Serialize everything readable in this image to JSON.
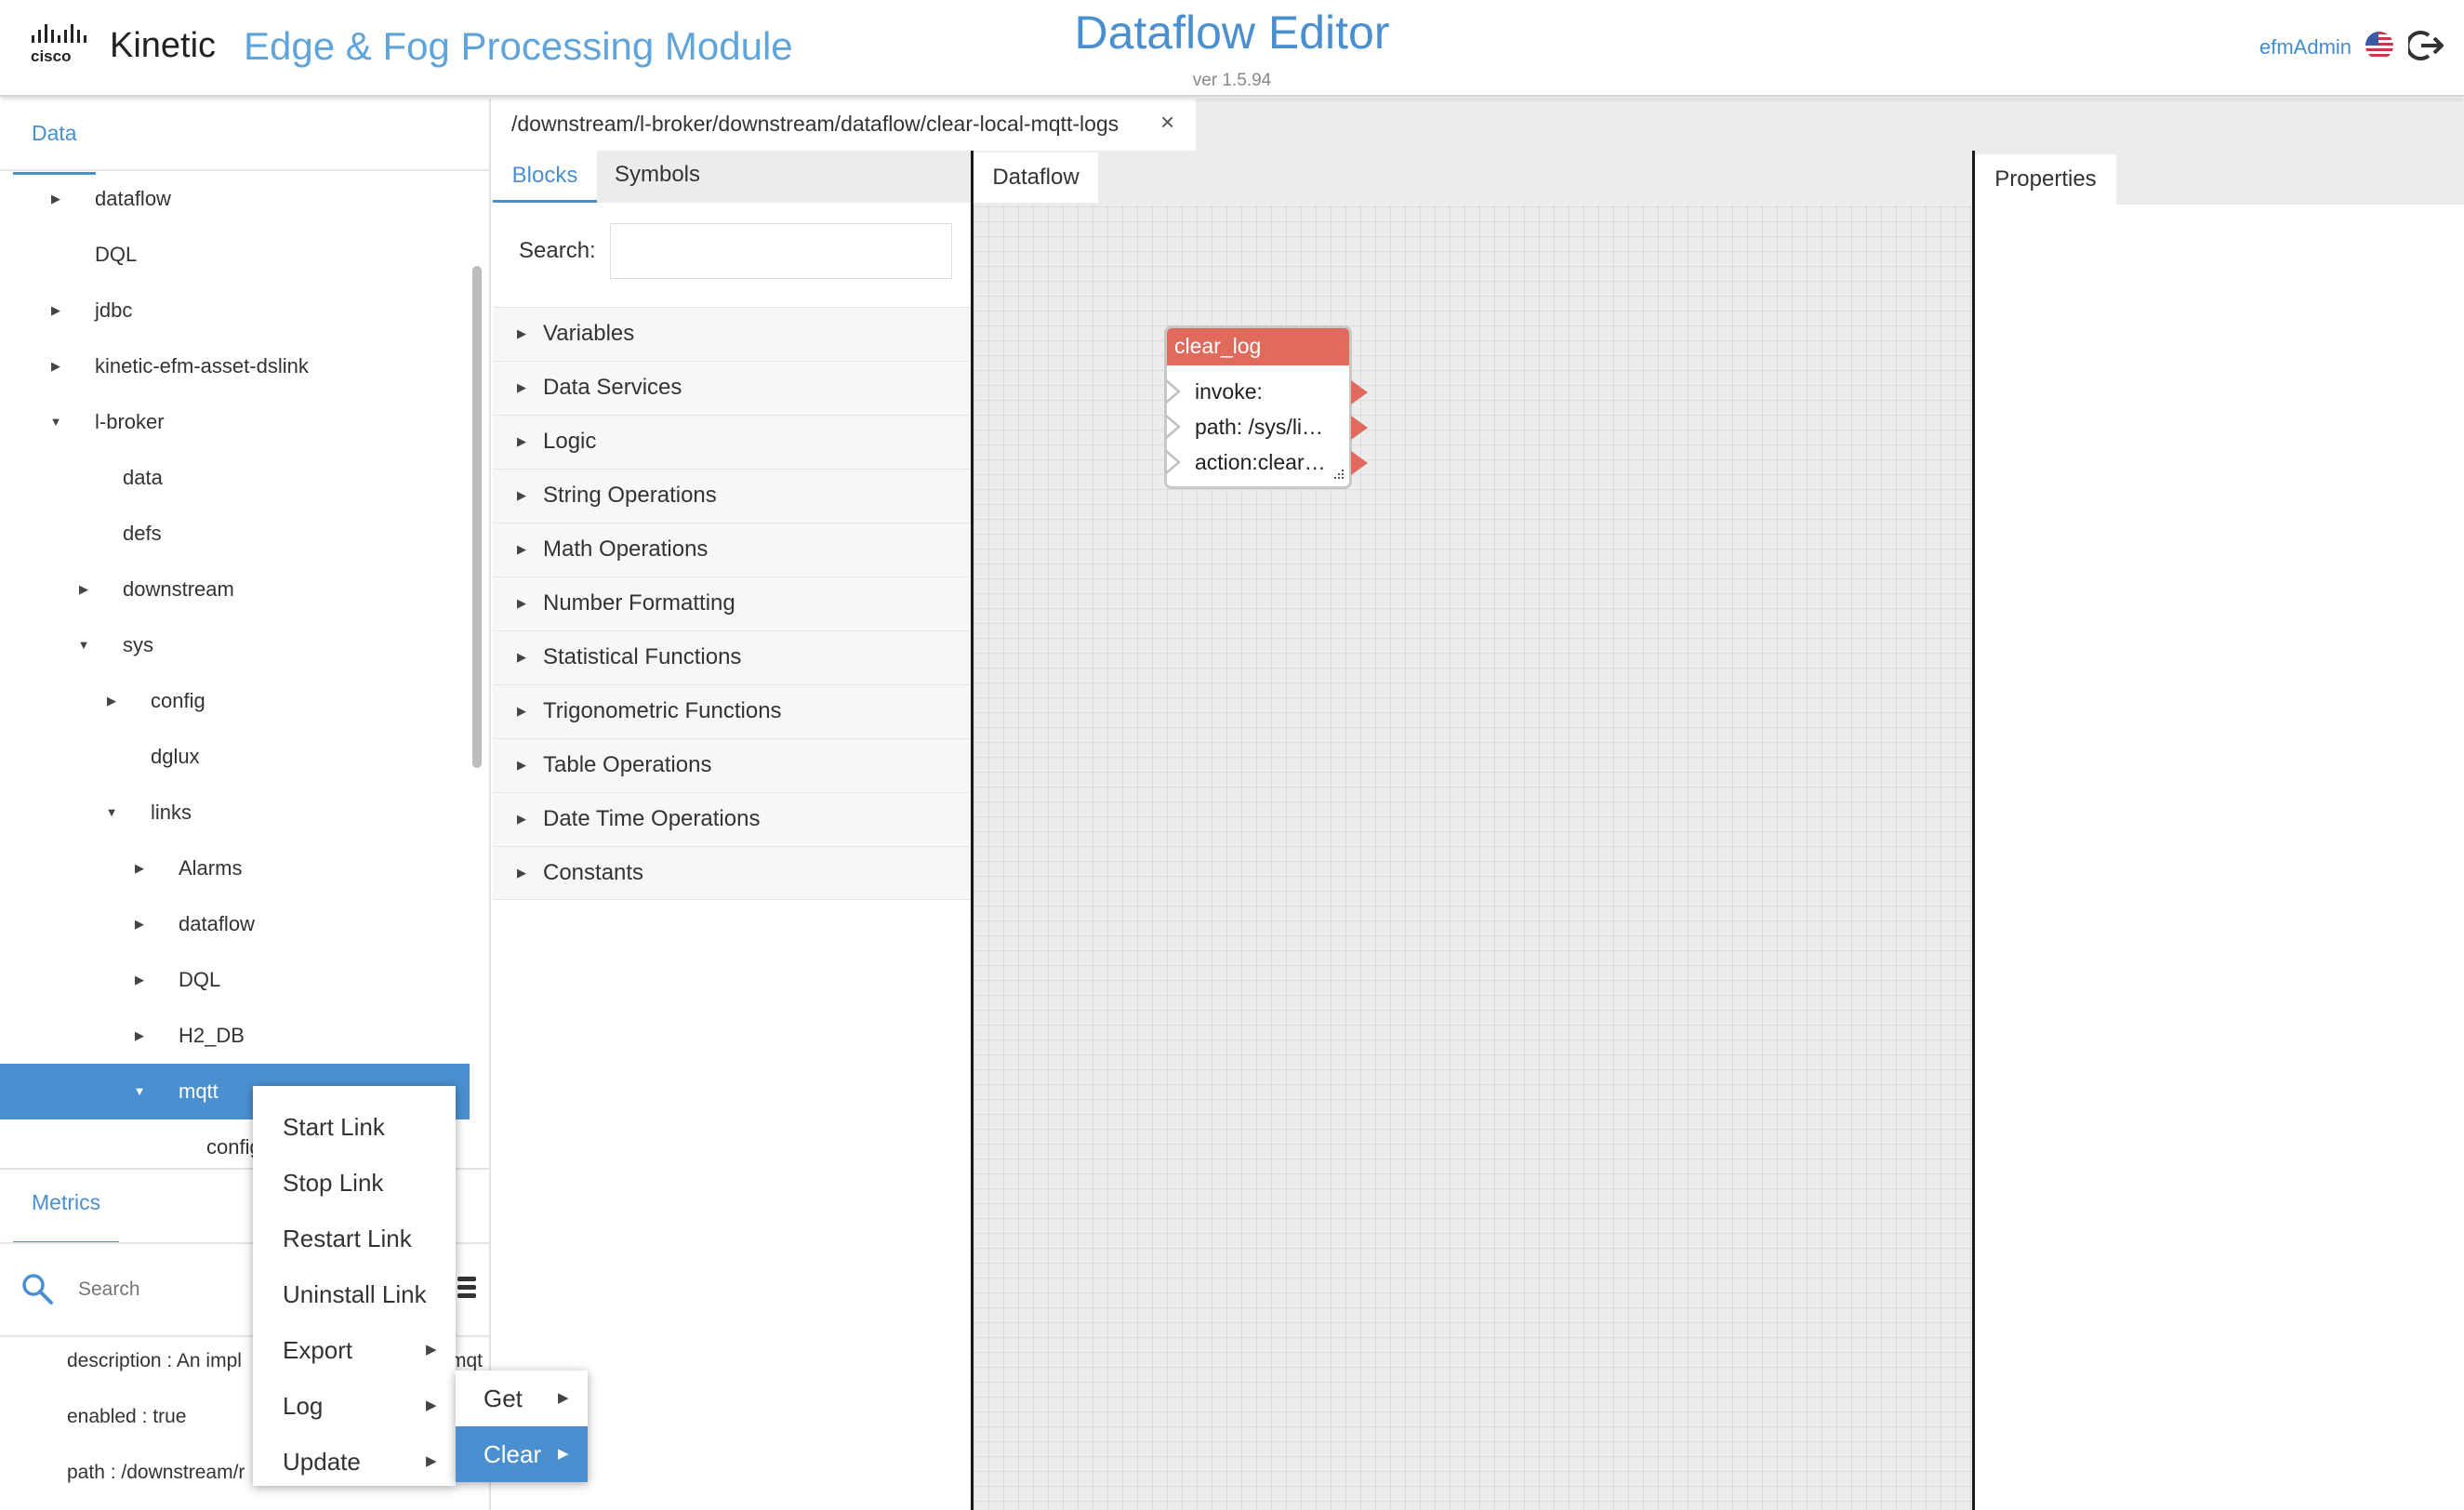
{
  "header": {
    "brand": "Kinetic",
    "module_title": "Edge & Fog Processing Module",
    "app_title": "Dataflow Editor",
    "version": "ver 1.5.94",
    "user": "efmAdmin"
  },
  "left_panel": {
    "tab_label": "Data",
    "tree": [
      {
        "label": "dataflow",
        "caret": "▶"
      },
      {
        "label": "DQL",
        "caret": ""
      },
      {
        "label": "jdbc",
        "caret": "▶"
      },
      {
        "label": "kinetic-efm-asset-dslink",
        "caret": "▶"
      },
      {
        "label": "l-broker",
        "caret": "▼"
      },
      {
        "label": "data",
        "caret": ""
      },
      {
        "label": "defs",
        "caret": ""
      },
      {
        "label": "downstream",
        "caret": "▶"
      },
      {
        "label": "sys",
        "caret": "▼"
      },
      {
        "label": "config",
        "caret": "▶"
      },
      {
        "label": "dglux",
        "caret": ""
      },
      {
        "label": "links",
        "caret": "▼"
      },
      {
        "label": "Alarms",
        "caret": "▶"
      },
      {
        "label": "dataflow",
        "caret": "▶"
      },
      {
        "label": "DQL",
        "caret": "▶"
      },
      {
        "label": "H2_DB",
        "caret": "▶"
      },
      {
        "label": "mqtt",
        "caret": "▼"
      },
      {
        "label": "config",
        "caret": ""
      }
    ]
  },
  "metrics": {
    "tab_label": "Metrics",
    "search_placeholder": "Search",
    "rows": [
      {
        "text": "description : An impl",
        "suffix": "mqt"
      },
      {
        "text": "enabled : true",
        "suffix": ""
      },
      {
        "text": "path : /downstream/r",
        "suffix": ""
      }
    ]
  },
  "path_tab": {
    "label": "/downstream/l-broker/downstream/dataflow/clear-local-mqtt-logs",
    "close": "×"
  },
  "blocks_panel": {
    "tabs": [
      "Blocks",
      "Symbols"
    ],
    "search_label": "Search:",
    "categories": [
      "Variables",
      "Data Services",
      "Logic",
      "String Operations",
      "Math Operations",
      "Number Formatting",
      "Statistical Functions",
      "Trigonometric Functions",
      "Table Operations",
      "Date Time Operations",
      "Constants"
    ]
  },
  "dataflow": {
    "tab_label": "Dataflow",
    "block": {
      "title": "clear_log",
      "ports": [
        "invoke:",
        "path:  /sys/li…",
        "action:clear…"
      ]
    }
  },
  "properties": {
    "tab_label": "Properties"
  },
  "context_menu": {
    "items": [
      {
        "label": "Start Link",
        "submenu": ""
      },
      {
        "label": "Stop Link",
        "submenu": ""
      },
      {
        "label": "Restart Link",
        "submenu": ""
      },
      {
        "label": "Uninstall Link",
        "submenu": ""
      },
      {
        "label": "Export",
        "submenu": "▶"
      },
      {
        "label": "Log",
        "submenu": "▶"
      },
      {
        "label": "Update",
        "submenu": "▶"
      }
    ],
    "submenu_items": [
      {
        "label": "Get",
        "submenu": "▶"
      },
      {
        "label": "Clear",
        "submenu": "▶"
      }
    ]
  },
  "colors": {
    "accent": "#4a90d0",
    "block_header": "#e06a5c"
  }
}
